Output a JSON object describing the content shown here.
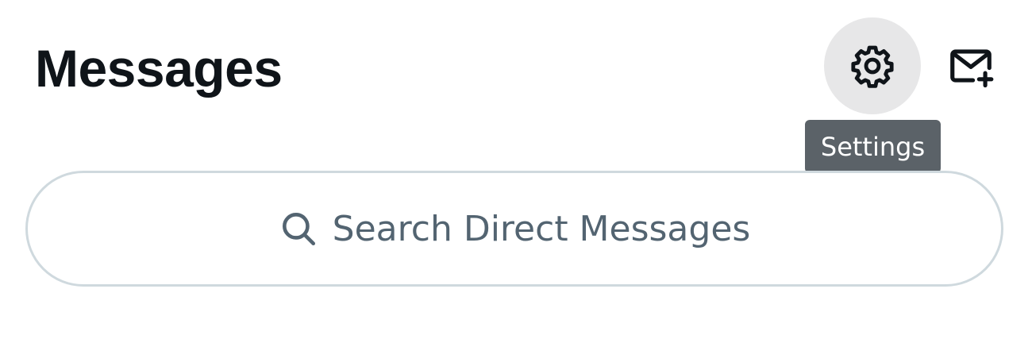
{
  "header": {
    "title": "Messages",
    "settings_icon": "gear-icon",
    "compose_icon": "envelope-plus-icon"
  },
  "tooltip": {
    "text": "Settings"
  },
  "search": {
    "placeholder": "Search Direct Messages",
    "icon": "search-icon"
  },
  "colors": {
    "title": "#0f1419",
    "icon": "#0f1419",
    "hover_circle": "#e7e7e8",
    "tooltip_bg": "#5b6268",
    "search_border": "#cfd9de",
    "search_text": "#536471"
  }
}
